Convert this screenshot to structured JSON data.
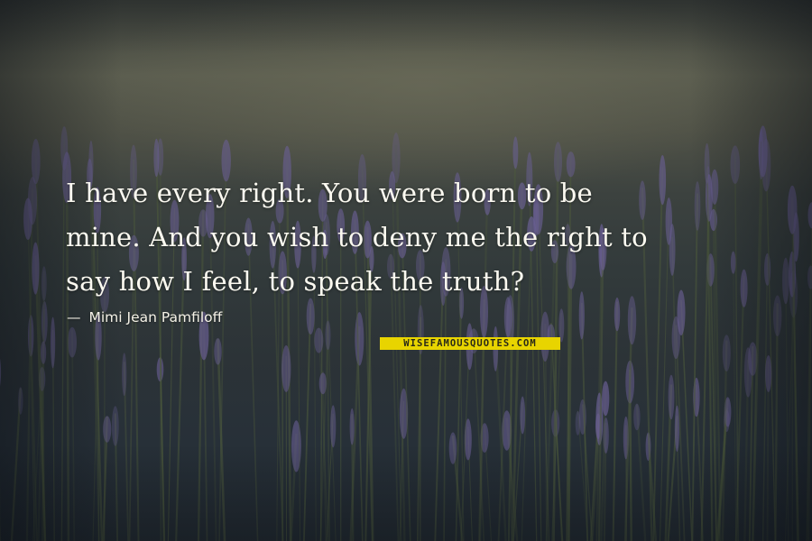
{
  "quote": {
    "lines": [
      "I have every right. You were born to be",
      "mine. And you wish to deny me the right to",
      "say how I feel, to speak the truth?"
    ],
    "author": "Mimi Jean Pamfiloff"
  },
  "watermark": {
    "text": "WISEFAMOUSQUOTES.COM"
  },
  "colors": {
    "text": "#fbf9f0",
    "watermark_bg": "#e8d400",
    "lavender": "#6a5f94",
    "foliage": "#4d5a3c"
  }
}
